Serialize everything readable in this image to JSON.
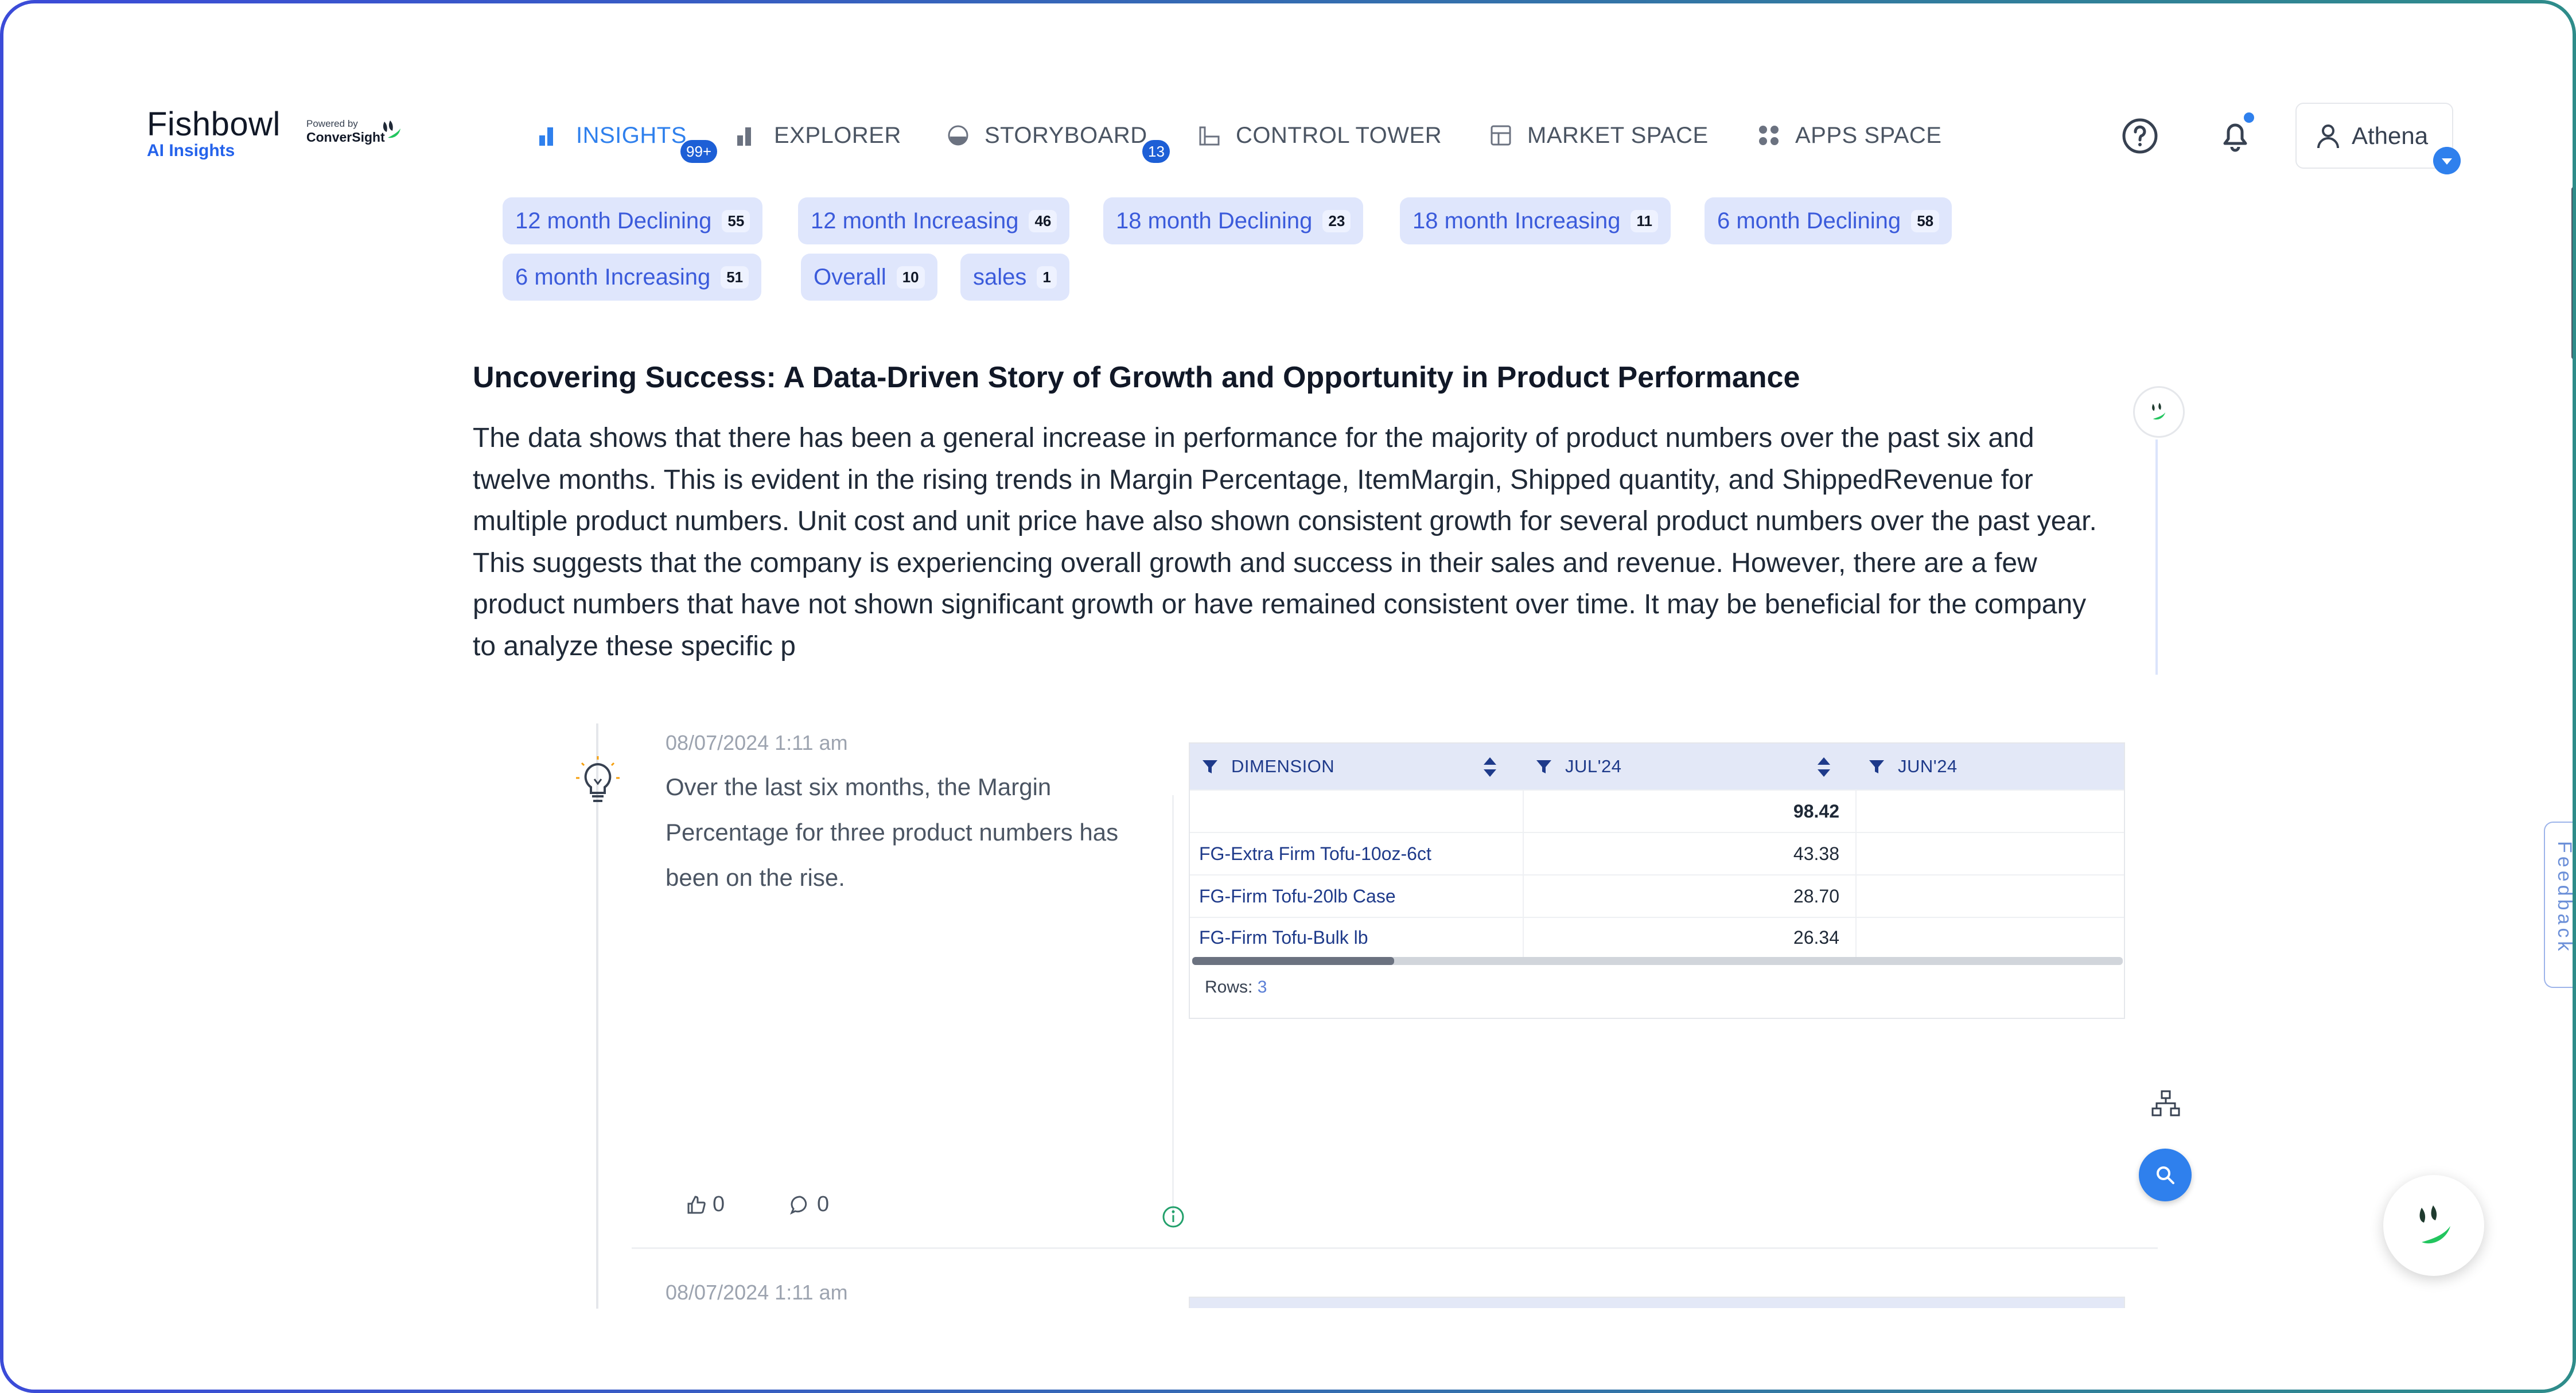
{
  "brand": {
    "title": "Fishbowl",
    "subtitle": "AI Insights",
    "powered_by": "Powered by",
    "powered_name": "ConverSight"
  },
  "nav": {
    "items": [
      {
        "label": "INSIGHTS",
        "badge": "99+",
        "active": true,
        "icon": "bar-chart-icon"
      },
      {
        "label": "EXPLORER",
        "badge": "",
        "active": false,
        "icon": "bar-chart-icon"
      },
      {
        "label": "STORYBOARD",
        "badge": "13",
        "active": false,
        "icon": "storyboard-icon"
      },
      {
        "label": "CONTROL TOWER",
        "badge": "",
        "active": false,
        "icon": "tower-icon"
      },
      {
        "label": "MARKET SPACE",
        "badge": "",
        "active": false,
        "icon": "market-icon"
      },
      {
        "label": "APPS SPACE",
        "badge": "",
        "active": false,
        "icon": "apps-grid-icon"
      }
    ]
  },
  "user": {
    "name": "Athena"
  },
  "chips": [
    {
      "label": "12 month Declining",
      "count": "55"
    },
    {
      "label": "12 month Increasing",
      "count": "46"
    },
    {
      "label": "18 month Declining",
      "count": "23"
    },
    {
      "label": "18 month Increasing",
      "count": "11"
    },
    {
      "label": "6 month Declining",
      "count": "58"
    },
    {
      "label": "6 month Increasing",
      "count": "51"
    },
    {
      "label": "Overall",
      "count": "10"
    },
    {
      "label": "sales",
      "count": "1"
    }
  ],
  "story": {
    "title": "Uncovering Success: A Data-Driven Story of Growth and Opportunity in Product Performance",
    "body": "The data shows that there has been a general increase in performance for the majority of product numbers over the past six and twelve months. This is evident in the rising trends in Margin Percentage, ItemMargin, Shipped quantity, and ShippedRevenue for multiple product numbers. Unit cost and unit price have also shown consistent growth for several product numbers over the past year. This suggests that the company is experiencing overall growth and success in their sales and revenue. However, there are a few product numbers that have not shown significant growth or have remained consistent over time. It may be beneficial for the company to analyze these specific p"
  },
  "insight": {
    "timestamp": "08/07/2024 1:11 am",
    "text": "Over the last six months, the Margin Percentage for three product numbers has been on the rise.",
    "likes": "0",
    "comments": "0",
    "table": {
      "columns": [
        "DIMENSION",
        "JUL'24",
        "JUN'24"
      ],
      "total_row": [
        "",
        "98.42",
        ""
      ],
      "rows": [
        [
          "FG-Extra Firm Tofu-10oz-6ct",
          "43.38",
          ""
        ],
        [
          "FG-Firm Tofu-20lb Case",
          "28.70",
          ""
        ],
        [
          "FG-Firm Tofu-Bulk lb",
          "26.34",
          ""
        ]
      ],
      "rows_label": "Rows:",
      "rows_count": "3"
    }
  },
  "insight2": {
    "timestamp": "08/07/2024 1:11 am"
  },
  "feedback": {
    "label": "Feedback"
  },
  "colors": {
    "accent": "#2f80ed",
    "chip_bg": "#dfe6fc",
    "chip_text": "#3b5bdb",
    "grid_head": "#e3e8f7"
  }
}
